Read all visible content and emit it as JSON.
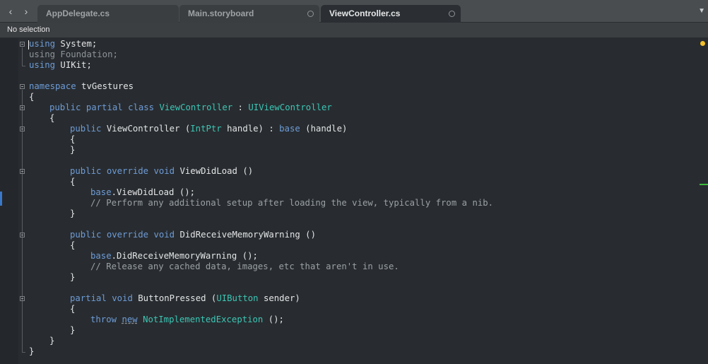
{
  "tabs": [
    {
      "label": "AppDelegate.cs",
      "active": false
    },
    {
      "label": "Main.storyboard",
      "active": false
    },
    {
      "label": "ViewController.cs",
      "active": true
    }
  ],
  "pathbar": {
    "text": "No selection"
  },
  "code": {
    "line1": {
      "kw": "using",
      "rest": " System;"
    },
    "line2": {
      "kw": "using",
      "rest": " Foundation;"
    },
    "line3": {
      "kw": "using",
      "rest": " UIKit;"
    },
    "line5": {
      "kw": "namespace",
      "rest": " tvGestures"
    },
    "line6": "{",
    "line7": {
      "kw1": "public",
      "kw2": "partial",
      "kw3": "class",
      "name": "ViewController",
      "sep": " : ",
      "base": "UIViewController"
    },
    "line8": "{",
    "line9": {
      "kw": "public",
      "name": " ViewController (",
      "type": "IntPtr",
      "mid": " handle) : ",
      "kw2": "base",
      "end": " (handle)"
    },
    "line10": "{",
    "line11": "}",
    "line13": {
      "kw1": "public",
      "kw2": "override",
      "kw3": "void",
      "rest": " ViewDidLoad ()"
    },
    "line14": "{",
    "line15": {
      "kw": "base",
      "rest": ".ViewDidLoad ();"
    },
    "line16": "// Perform any additional setup after loading the view, typically from a nib.",
    "line17": "}",
    "line19": {
      "kw1": "public",
      "kw2": "override",
      "kw3": "void",
      "rest": " DidReceiveMemoryWarning ()"
    },
    "line20": "{",
    "line21": {
      "kw": "base",
      "rest": ".DidReceiveMemoryWarning ();"
    },
    "line22": "// Release any cached data, images, etc that aren't in use.",
    "line23": "}",
    "line25": {
      "kw1": "partial",
      "kw2": "void",
      "name": " ButtonPressed (",
      "type": "UIButton",
      "end": " sender)"
    },
    "line26": "{",
    "line27": {
      "kw1": "throw",
      "kw2": "new",
      "type": "NotImplementedException",
      "end": " ();"
    },
    "line28": "}",
    "line29": "}",
    "line30": "}"
  },
  "colors": {
    "keyword": "#6e9bd6",
    "type": "#3cc6b5",
    "comment": "#9aa0a5",
    "text": "#e3e4e5"
  }
}
